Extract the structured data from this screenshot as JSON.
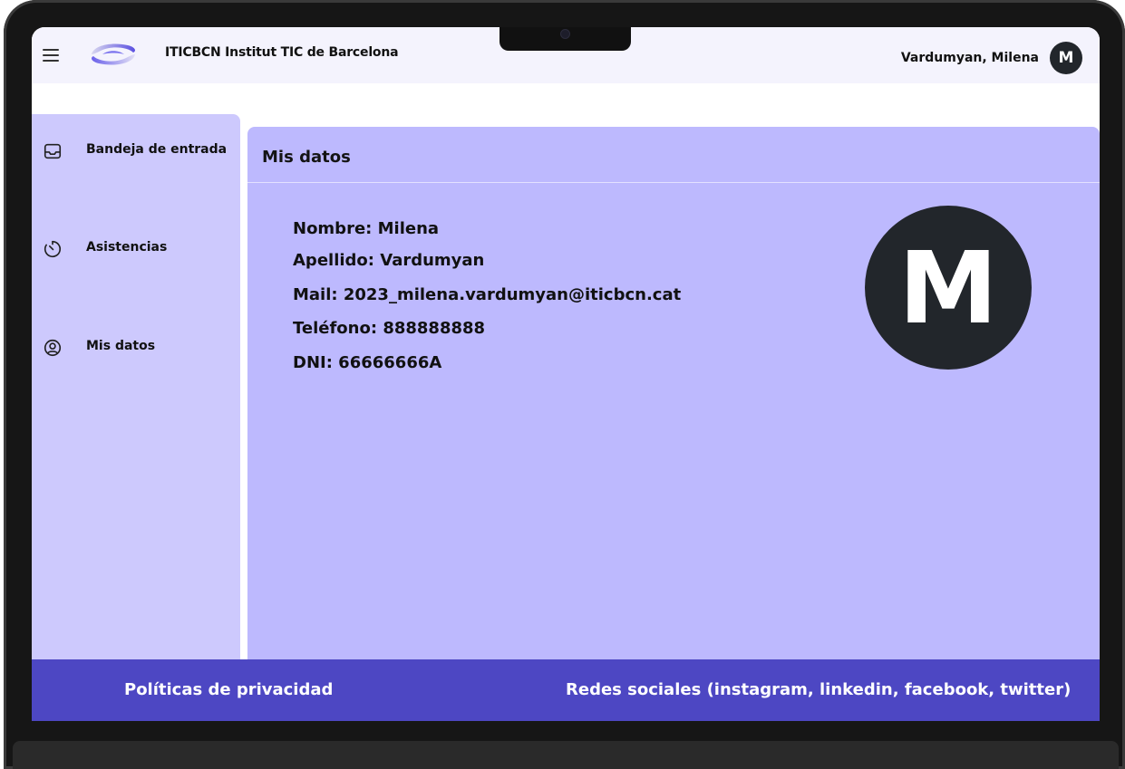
{
  "header": {
    "brand": "ITICBCN Institut TIC de Barcelona",
    "user_name": "Vardumyan, Milena",
    "user_initial": "M"
  },
  "sidebar": {
    "items": [
      {
        "label": "Bandeja de entrada",
        "icon": "inbox-icon"
      },
      {
        "label": "Asistencias",
        "icon": "timer-icon"
      },
      {
        "label": "Mis datos",
        "icon": "user-circle-icon"
      }
    ]
  },
  "main": {
    "title": "Mis datos",
    "avatar_initial": "M",
    "fields": [
      "Nombre:  Milena",
      "Apellido:  Vardumyan",
      "Mail: 2023_milena.vardumyan@iticbcn.cat",
      "Teléfono:  888888888",
      "DNI:  66666666A"
    ]
  },
  "footer": {
    "privacy": "Políticas de privacidad",
    "social": "Redes sociales (instagram, linkedin, facebook, twitter)"
  },
  "colors": {
    "sidebar_bg": "#cdc9fd",
    "main_bg": "#bdb9fe",
    "footer_bg": "#4d47c3",
    "avatar_bg": "#22262b"
  }
}
